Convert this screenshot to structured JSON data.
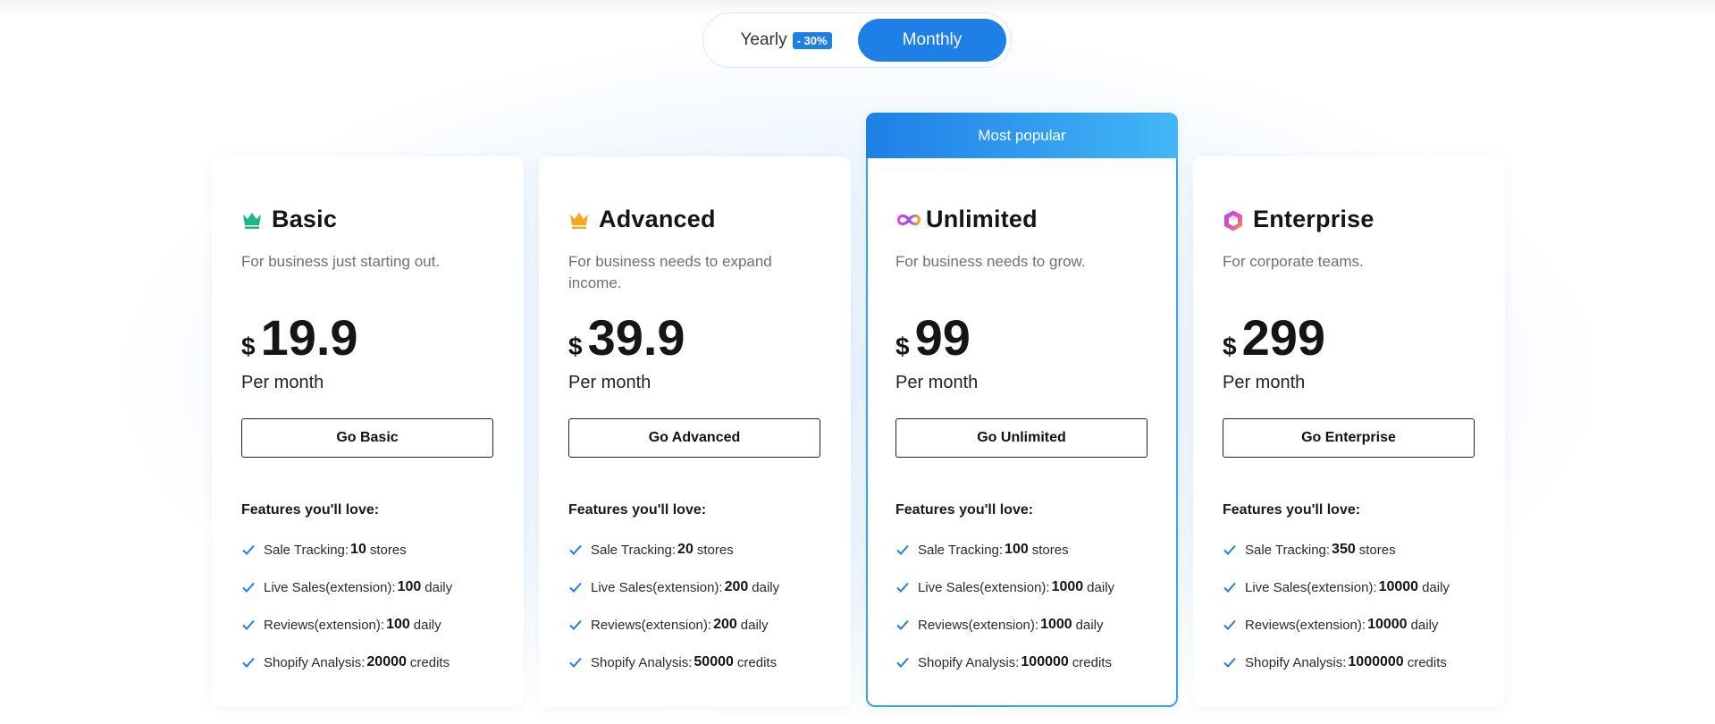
{
  "billing_toggle": {
    "yearly_label": "Yearly",
    "yearly_discount": "- 30%",
    "monthly_label": "Monthly",
    "selected": "Monthly"
  },
  "colors": {
    "accent": "#1e7fe6",
    "popular_gradient_end": "#43b6f7",
    "check": "#1e7fe6"
  },
  "features_title": "Features you'll love:",
  "plans": [
    {
      "name": "Basic",
      "icon": "crown-icon",
      "description": "For business just starting out.",
      "currency": "$",
      "price": "19.9",
      "period": "Per month",
      "button": "Go Basic",
      "features": [
        {
          "label": "Sale Tracking:",
          "value": "10",
          "unit": "stores"
        },
        {
          "label": "Live Sales(extension):",
          "value": "100",
          "unit": "daily"
        },
        {
          "label": "Reviews(extension):",
          "value": "100",
          "unit": "daily"
        },
        {
          "label": "Shopify Analysis:",
          "value": "20000",
          "unit": "credits"
        }
      ]
    },
    {
      "name": "Advanced",
      "icon": "crown-icon",
      "description": "For business needs to expand income.",
      "currency": "$",
      "price": "39.9",
      "period": "Per month",
      "button": "Go Advanced",
      "features": [
        {
          "label": "Sale Tracking:",
          "value": "20",
          "unit": "stores"
        },
        {
          "label": "Live Sales(extension):",
          "value": "200",
          "unit": "daily"
        },
        {
          "label": "Reviews(extension):",
          "value": "200",
          "unit": "daily"
        },
        {
          "label": "Shopify Analysis:",
          "value": "50000",
          "unit": "credits"
        }
      ]
    },
    {
      "name": "Unlimited",
      "icon": "infinity-icon",
      "badge": "Most popular",
      "description": "For business needs to grow.",
      "currency": "$",
      "price": "99",
      "period": "Per month",
      "button": "Go Unlimited",
      "features": [
        {
          "label": "Sale Tracking:",
          "value": "100",
          "unit": "stores"
        },
        {
          "label": "Live Sales(extension):",
          "value": "1000",
          "unit": "daily"
        },
        {
          "label": "Reviews(extension):",
          "value": "1000",
          "unit": "daily"
        },
        {
          "label": "Shopify Analysis:",
          "value": "100000",
          "unit": "credits"
        }
      ]
    },
    {
      "name": "Enterprise",
      "icon": "cube-icon",
      "description": "For corporate teams.",
      "currency": "$",
      "price": "299",
      "period": "Per month",
      "button": "Go Enterprise",
      "features": [
        {
          "label": "Sale Tracking:",
          "value": "350",
          "unit": "stores"
        },
        {
          "label": "Live Sales(extension):",
          "value": "10000",
          "unit": "daily"
        },
        {
          "label": "Reviews(extension):",
          "value": "10000",
          "unit": "daily"
        },
        {
          "label": "Shopify Analysis:",
          "value": "1000000",
          "unit": "credits"
        }
      ]
    }
  ]
}
